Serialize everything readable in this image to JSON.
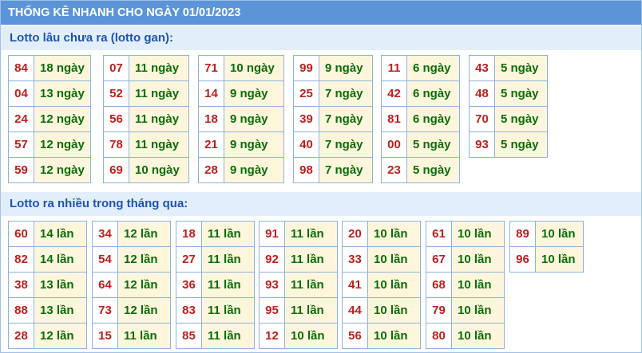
{
  "title": "THỐNG KÊ NHANH CHO NGÀY 01/01/2023",
  "gan_heading": "Lotto lâu chưa ra (lotto gan):",
  "freq_heading": "Lotto ra nhiều trong tháng qua:",
  "gan": [
    [
      {
        "n": "84",
        "v": "18 ngày"
      },
      {
        "n": "04",
        "v": "13 ngày"
      },
      {
        "n": "24",
        "v": "12 ngày"
      },
      {
        "n": "57",
        "v": "12 ngày"
      },
      {
        "n": "59",
        "v": "12 ngày"
      }
    ],
    [
      {
        "n": "07",
        "v": "11 ngày"
      },
      {
        "n": "52",
        "v": "11 ngày"
      },
      {
        "n": "56",
        "v": "11 ngày"
      },
      {
        "n": "78",
        "v": "11 ngày"
      },
      {
        "n": "69",
        "v": "10 ngày"
      }
    ],
    [
      {
        "n": "71",
        "v": "10 ngày"
      },
      {
        "n": "14",
        "v": "9 ngày"
      },
      {
        "n": "18",
        "v": "9 ngày"
      },
      {
        "n": "21",
        "v": "9 ngày"
      },
      {
        "n": "28",
        "v": "9 ngày"
      }
    ],
    [
      {
        "n": "99",
        "v": "9 ngày"
      },
      {
        "n": "25",
        "v": "7 ngày"
      },
      {
        "n": "39",
        "v": "7 ngày"
      },
      {
        "n": "40",
        "v": "7 ngày"
      },
      {
        "n": "98",
        "v": "7 ngày"
      }
    ],
    [
      {
        "n": "11",
        "v": "6 ngày"
      },
      {
        "n": "42",
        "v": "6 ngày"
      },
      {
        "n": "81",
        "v": "6 ngày"
      },
      {
        "n": "00",
        "v": "5 ngày"
      },
      {
        "n": "23",
        "v": "5 ngày"
      }
    ],
    [
      {
        "n": "43",
        "v": "5 ngày"
      },
      {
        "n": "48",
        "v": "5 ngày"
      },
      {
        "n": "70",
        "v": "5 ngày"
      },
      {
        "n": "93",
        "v": "5 ngày"
      }
    ]
  ],
  "freq": [
    [
      {
        "n": "60",
        "v": "14 lần"
      },
      {
        "n": "82",
        "v": "14 lần"
      },
      {
        "n": "38",
        "v": "13 lần"
      },
      {
        "n": "88",
        "v": "13 lần"
      },
      {
        "n": "28",
        "v": "12 lần"
      }
    ],
    [
      {
        "n": "34",
        "v": "12 lần"
      },
      {
        "n": "54",
        "v": "12 lần"
      },
      {
        "n": "64",
        "v": "12 lần"
      },
      {
        "n": "73",
        "v": "12 lần"
      },
      {
        "n": "15",
        "v": "11 lần"
      }
    ],
    [
      {
        "n": "18",
        "v": "11 lần"
      },
      {
        "n": "27",
        "v": "11 lần"
      },
      {
        "n": "36",
        "v": "11 lần"
      },
      {
        "n": "83",
        "v": "11 lần"
      },
      {
        "n": "85",
        "v": "11 lần"
      }
    ],
    [
      {
        "n": "91",
        "v": "11 lần"
      },
      {
        "n": "92",
        "v": "11 lần"
      },
      {
        "n": "93",
        "v": "11 lần"
      },
      {
        "n": "95",
        "v": "11 lần"
      },
      {
        "n": "12",
        "v": "10 lần"
      }
    ],
    [
      {
        "n": "20",
        "v": "10 lần"
      },
      {
        "n": "33",
        "v": "10 lần"
      },
      {
        "n": "41",
        "v": "10 lần"
      },
      {
        "n": "44",
        "v": "10 lần"
      },
      {
        "n": "56",
        "v": "10 lần"
      }
    ],
    [
      {
        "n": "61",
        "v": "10 lần"
      },
      {
        "n": "67",
        "v": "10 lần"
      },
      {
        "n": "68",
        "v": "10 lần"
      },
      {
        "n": "79",
        "v": "10 lần"
      },
      {
        "n": "80",
        "v": "10 lần"
      }
    ],
    [
      {
        "n": "89",
        "v": "10 lần"
      },
      {
        "n": "96",
        "v": "10 lần"
      }
    ]
  ]
}
